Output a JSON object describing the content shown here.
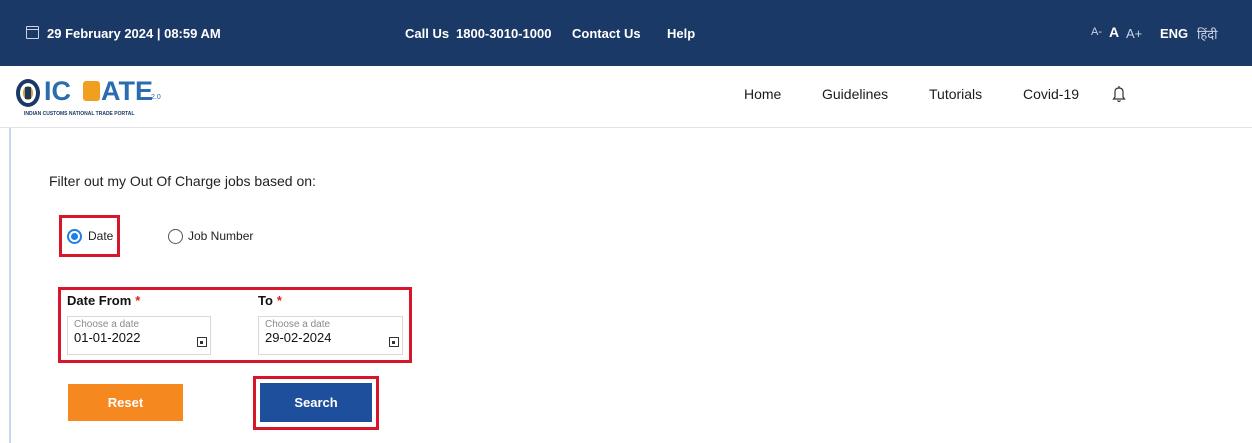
{
  "topbar": {
    "datetime": "29 February 2024 | 08:59 AM",
    "call_label": "Call Us",
    "call_number": "1800-3010-1000",
    "contact": "Contact Us",
    "help": "Help",
    "font_small": "A-",
    "font_normal": "A",
    "font_large": "A+",
    "lang_eng": "ENG",
    "lang_hindi": "हिंदी",
    "bg_color": "#1b3966"
  },
  "logo": {
    "text_ic": "IC",
    "text_ate": "ATE",
    "version": "2.0",
    "tagline": "INDIAN CUSTOMS NATIONAL TRADE PORTAL"
  },
  "nav": {
    "home": "Home",
    "guidelines": "Guidelines",
    "tutorials": "Tutorials",
    "covid": "Covid-19"
  },
  "filter": {
    "title": "Filter out my Out Of Charge jobs based on:",
    "option_date": "Date",
    "option_job": "Job Number",
    "selected": "Date"
  },
  "date_from": {
    "label": "Date From",
    "placeholder": "Choose a date",
    "value": "01-01-2022"
  },
  "date_to": {
    "label": "To",
    "placeholder": "Choose a date",
    "value": "29-02-2024"
  },
  "required_mark": "*",
  "buttons": {
    "reset": "Reset",
    "search": "Search",
    "reset_color": "#f5881f",
    "search_color": "#1e4f9c"
  },
  "highlight_color": "#d7152b"
}
